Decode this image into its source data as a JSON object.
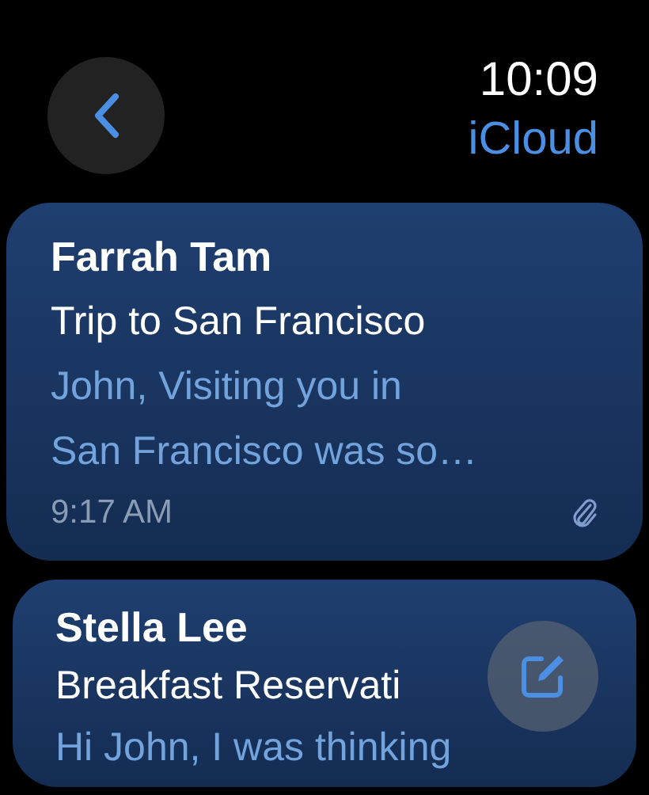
{
  "status": {
    "time": "10:09",
    "account": "iCloud"
  },
  "messages": [
    {
      "sender": "Farrah Tam",
      "subject": "Trip to San Francisco",
      "preview": "John, Visiting you in San Francisco was so…",
      "time": "9:17 AM",
      "attachment": true
    },
    {
      "sender": "Stella Lee",
      "subject": "Breakfast Reservati",
      "preview": "Hi John, I was thinking"
    }
  ]
}
